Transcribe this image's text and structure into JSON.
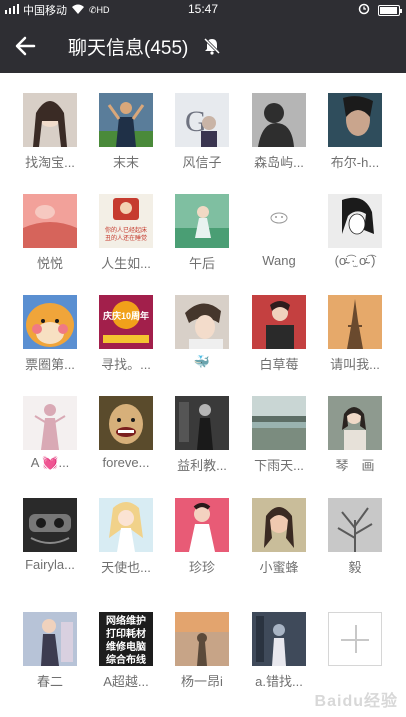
{
  "status_bar": {
    "carrier": "中国移动",
    "hd": "HD",
    "time": "15:47"
  },
  "header": {
    "title": "聊天信息(455)"
  },
  "members": [
    {
      "name": "找淘宝...",
      "bg": "#d8cfc7",
      "fg": "#3a2b25"
    },
    {
      "name": "末末",
      "bg": "#5a7d9a",
      "fg": "#1f3047"
    },
    {
      "name": "风信子",
      "bg": "#e7eaee",
      "fg": "#6f7380"
    },
    {
      "name": "森岛屿...",
      "bg": "#b5b5b5",
      "fg": "#2e2e2e"
    },
    {
      "name": "布尔-h...",
      "bg": "#2f4d5c",
      "fg": "#c9a58d"
    },
    {
      "name": "悦悦",
      "bg": "#f2a19a",
      "fg": "#d6645b"
    },
    {
      "name": "人生如...",
      "bg": "#f3efe6",
      "fg": "#c4372a"
    },
    {
      "name": "午后",
      "bg": "#7fbfa1",
      "fg": "#e8f2f0"
    },
    {
      "name": "Wang",
      "bg": "#ffffff",
      "fg": "#9a9a9a"
    },
    {
      "name": "(ơ̴̴͡ ·̫ ơ̴̴͡ )",
      "bg": "#ececec",
      "fg": "#1b1b1b"
    },
    {
      "name": "票圈第...",
      "bg": "#f0a53a",
      "fg": "#f7e0c2"
    },
    {
      "name": "寻找。...",
      "bg": "#a21f4b",
      "fg": "#f4c430"
    },
    {
      "name": "🐳",
      "bg": "#d8d0c8",
      "fg": "#45362c"
    },
    {
      "name": "白草莓",
      "bg": "#c44040",
      "fg": "#2d1c1c"
    },
    {
      "name": "请叫我...",
      "bg": "#e6a96a",
      "fg": "#6a4a2e"
    },
    {
      "name": "A 💓...",
      "bg": "#f4f0f0",
      "fg": "#d9a9b5"
    },
    {
      "name": "foreve...",
      "bg": "#5a4b2c",
      "fg": "#d7b07a"
    },
    {
      "name": "益利教...",
      "bg": "#3a3a3a",
      "fg": "#b5b5b5"
    },
    {
      "name": "下雨天...",
      "bg": "#9ab3b0",
      "fg": "#5d6e66"
    },
    {
      "name": "琴　画",
      "bg": "#8e9a8f",
      "fg": "#e7e1d9"
    },
    {
      "name": "Fairyla...",
      "bg": "#2a2a2a",
      "fg": "#777777"
    },
    {
      "name": "天使也...",
      "bg": "#d8ecf3",
      "fg": "#f1d28a"
    },
    {
      "name": "珍珍",
      "bg": "#e85b76",
      "fg": "#f4d2c0"
    },
    {
      "name": "小蜜蜂",
      "bg": "#c9bd9a",
      "fg": "#3a2a22"
    },
    {
      "name": "毅",
      "bg": "#c8c8c8",
      "fg": "#5a5a5a"
    },
    {
      "name": "春二",
      "bg": "#b7c3d7",
      "fg": "#3c3c50"
    },
    {
      "name": "A超越...",
      "bg": "#1d1d1d",
      "fg": "#ffffff"
    },
    {
      "name": "杨一昂i",
      "bg": "#c7a487",
      "fg": "#5b4a3b"
    },
    {
      "name": "a.错找...",
      "bg": "#3f4a5a",
      "fg": "#a8b4c4"
    }
  ],
  "avatar_texts": {
    "m7": "你的人已经起床\n丑的人还在睡觉",
    "m12": "庆庆10周年",
    "m27": "网络维护\n打印耗材\n维修电脑\n综合布线"
  },
  "watermark": "Baidu经验"
}
